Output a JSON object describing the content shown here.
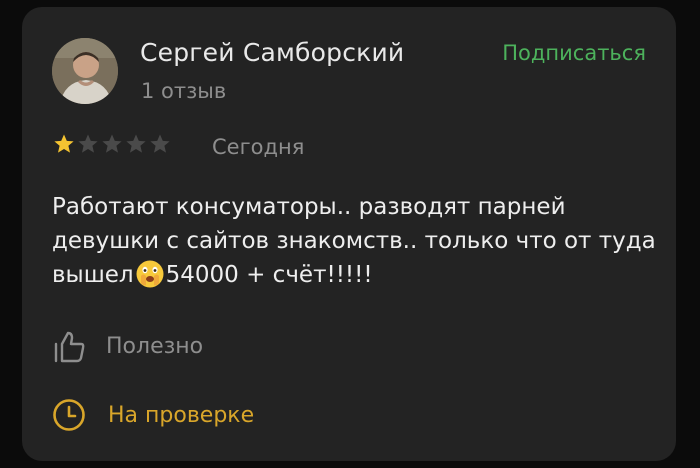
{
  "review": {
    "author": {
      "name": "Сергей Самборский",
      "review_count": "1 отзыв",
      "avatar_icon": "user-photo"
    },
    "subscribe_label": "Подписаться",
    "rating": {
      "value": 1,
      "max": 5,
      "filled_color": "#f5c431",
      "empty_color": "#4a4a4a"
    },
    "date": "Сегодня",
    "text_part1": "Работают консуматоры.. разводят парней девушки с сайтов знакомств.. только что от туда вышел",
    "text_emoji": "face-with-hand-over-mouth-icon",
    "text_part2": "54000 + счёт!!!!!",
    "useful_label": "Полезно",
    "status_label": "На проверке"
  },
  "colors": {
    "background": "#0b0b0b",
    "card": "#232323",
    "accent_green": "#4db25c",
    "status_yellow": "#d9a62a",
    "muted_text": "#8e8e8e"
  }
}
